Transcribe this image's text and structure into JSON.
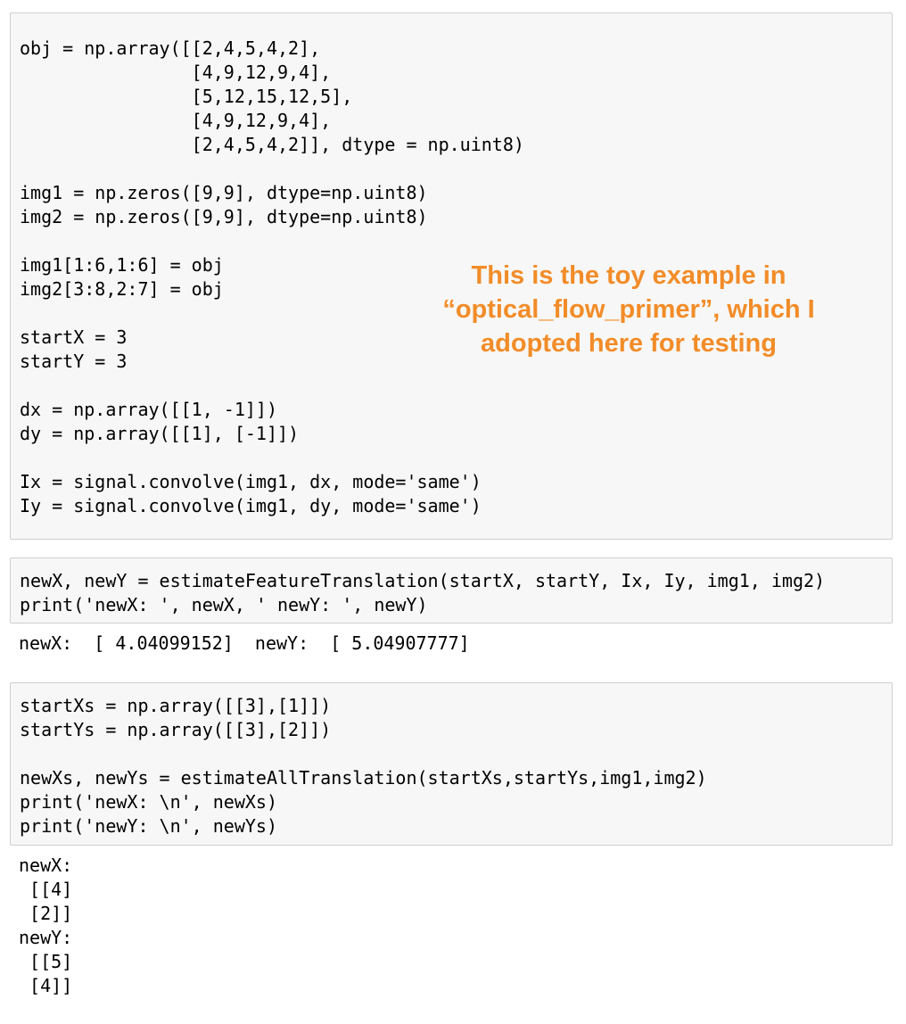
{
  "cells": [
    {
      "lines": [
        "obj = np.array([[2,4,5,4,2],",
        "                [4,9,12,9,4],",
        "                [5,12,15,12,5],",
        "                [4,9,12,9,4],",
        "                [2,4,5,4,2]], dtype = np.uint8)",
        "",
        "img1 = np.zeros([9,9], dtype=np.uint8)",
        "img2 = np.zeros([9,9], dtype=np.uint8)",
        "",
        "img1[1:6,1:6] = obj",
        "img2[3:8,2:7] = obj",
        "",
        "startX = 3",
        "startY = 3",
        "",
        "dx = np.array([[1, -1]])",
        "dy = np.array([[1], [-1]])",
        "",
        "Ix = signal.convolve(img1, dx, mode='same')",
        "Iy = signal.convolve(img1, dy, mode='same')"
      ]
    },
    {
      "lines": [
        "newX, newY = estimateFeatureTranslation(startX, startY, Ix, Iy, img1, img2)",
        "print('newX: ', newX, ' newY: ', newY)"
      ],
      "output": [
        "newX:  [ 4.04099152]  newY:  [ 5.04907777]"
      ]
    },
    {
      "lines": [
        "startXs = np.array([[3],[1]])",
        "startYs = np.array([[3],[2]])",
        "",
        "newXs, newYs = estimateAllTranslation(startXs,startYs,img1,img2)",
        "print('newX: \\n', newXs)",
        "print('newY: \\n', newYs)"
      ],
      "output": [
        "newX: ",
        " [[4]",
        " [2]]",
        "newY: ",
        " [[5]",
        " [4]]"
      ]
    }
  ],
  "annotation": {
    "lines": [
      "This is the toy example in",
      "“optical_flow_primer”, which I",
      "adopted here for testing"
    ],
    "color": "#f28c28"
  }
}
